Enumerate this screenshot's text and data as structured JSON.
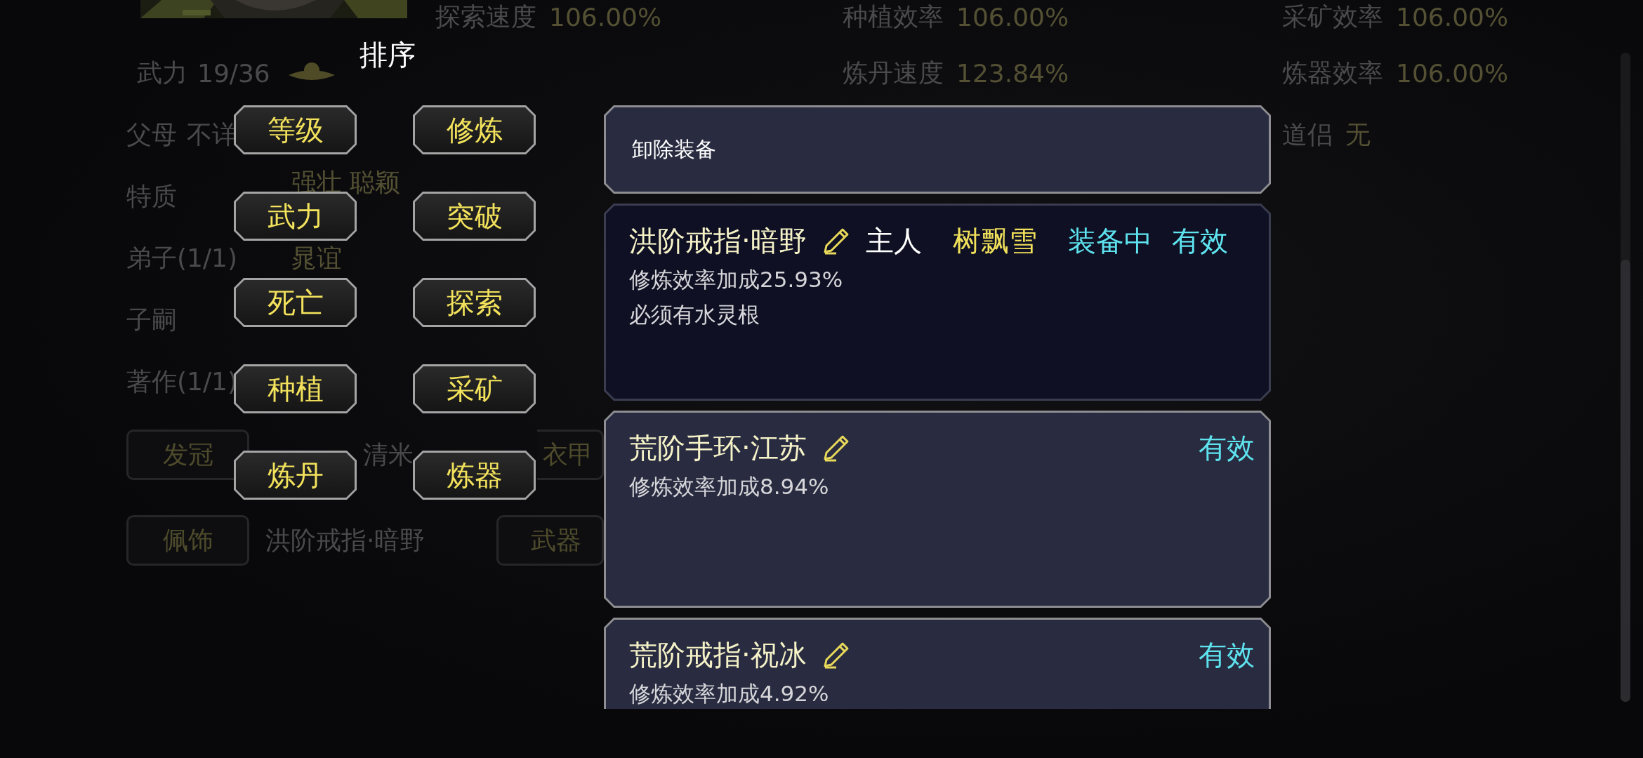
{
  "background": {
    "stats": [
      {
        "label": "探索速度",
        "value": "106.00%"
      },
      {
        "label": "种植效率",
        "value": "106.00%"
      },
      {
        "label": "采矿效率",
        "value": "106.00%"
      },
      {
        "label": "炼丹速度",
        "value": "123.84%"
      },
      {
        "label": "炼器效率",
        "value": "106.00%"
      },
      {
        "label": "道侣",
        "value": "无"
      }
    ],
    "profile": [
      {
        "kind": "power",
        "label": "武力",
        "value": "19/36"
      },
      {
        "kind": "inline",
        "label": "父母",
        "value": "不详"
      },
      {
        "kind": "column",
        "label": "特质",
        "value": "强壮 聪颖"
      },
      {
        "kind": "column",
        "label": "弟子(1/1)",
        "value": "晁谊"
      },
      {
        "kind": "column",
        "label": "子嗣"
      },
      {
        "kind": "column",
        "label": "著作(1/1)"
      }
    ],
    "equipment_rows": [
      [
        {
          "slot": "发冠",
          "item": "清米"
        },
        {
          "slot": "衣甲"
        }
      ],
      [
        {
          "slot": "佩饰",
          "item": "洪阶戒指·暗野"
        },
        {
          "slot": "武器"
        }
      ]
    ]
  },
  "sort_menu": {
    "title": "排序",
    "options": [
      "等级",
      "修炼",
      "武力",
      "突破",
      "死亡",
      "探索",
      "种植",
      "采矿",
      "炼丹",
      "炼器"
    ]
  },
  "equipment_list": {
    "unequip_label": "卸除装备",
    "items": [
      {
        "name": "洪阶戒指·暗野",
        "selected": true,
        "owner_label": "主人",
        "owner": "树飘雪",
        "status": "装备中",
        "validity": "有效",
        "effects": [
          "修炼效率加成25.93%",
          "必须有水灵根"
        ]
      },
      {
        "name": "荒阶手环·江苏",
        "selected": false,
        "validity": "有效",
        "effects": [
          "修炼效率加成8.94%"
        ]
      },
      {
        "name": "荒阶戒指·祝冰",
        "selected": false,
        "validity": "有效",
        "effects": [
          "修炼效率加成4.92%"
        ]
      }
    ]
  }
}
